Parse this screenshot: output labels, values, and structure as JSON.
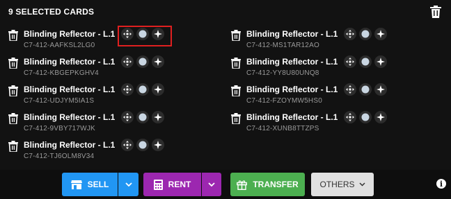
{
  "header": {
    "title": "9 SELECTED CARDS",
    "trash_icon": "trash-icon"
  },
  "cards": [
    {
      "name": "Blinding Reflector - L.1",
      "code": "C7-412-AAFKSL2LG0"
    },
    {
      "name": "Blinding Reflector - L.1",
      "code": "C7-412-MS1TAR12AO"
    },
    {
      "name": "Blinding Reflector - L.1",
      "code": "C7-412-KBGEPKGHV4"
    },
    {
      "name": "Blinding Reflector - L.1",
      "code": "C7-412-YY8U80UNQ8"
    },
    {
      "name": "Blinding Reflector - L.1",
      "code": "C7-412-UDJYM5IA1S"
    },
    {
      "name": "Blinding Reflector - L.1",
      "code": "C7-412-FZOYMW5HS0"
    },
    {
      "name": "Blinding Reflector - L.1",
      "code": "C7-412-9VBY717WJK"
    },
    {
      "name": "Blinding Reflector - L.1",
      "code": "C7-412-XUNB8TTZPS"
    },
    {
      "name": "Blinding Reflector - L.1",
      "code": "C7-412-TJ6OLM8V34"
    }
  ],
  "stat_icons": [
    "move-arrows-icon",
    "circle-dot-icon",
    "diamond-sparkle-icon"
  ],
  "toolbar": {
    "sell_label": "SELL",
    "rent_label": "RENT",
    "transfer_label": "TRANSFER",
    "others_label": "OTHERS"
  },
  "colors": {
    "background": "#121212",
    "sell": "#2196f3",
    "rent": "#9c27b0",
    "transfer": "#4caf50",
    "others": "#e0e0e0",
    "highlight": "#e02020"
  }
}
